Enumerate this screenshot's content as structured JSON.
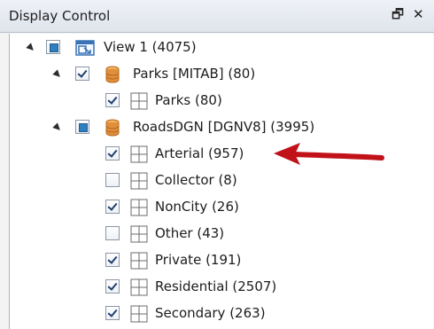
{
  "window": {
    "title": "Display Control",
    "pin_glyph": "🗗",
    "close_glyph": "✕"
  },
  "tree": {
    "view": {
      "label": "View 1 (4075)",
      "expanded": true,
      "check_state": "partial"
    },
    "parks_dataset": {
      "label": "Parks [MITAB] (80)",
      "expanded": true,
      "check_state": "checked"
    },
    "parks_layer": {
      "label": "Parks (80)",
      "check_state": "checked"
    },
    "roads_dataset": {
      "label": "RoadsDGN [DGNV8] (3995)",
      "expanded": true,
      "check_state": "partial"
    },
    "roads_layers": [
      {
        "label": "Arterial (957)",
        "check_state": "checked"
      },
      {
        "label": "Collector (8)",
        "check_state": "unchecked"
      },
      {
        "label": "NonCity (26)",
        "check_state": "checked"
      },
      {
        "label": "Other (43)",
        "check_state": "unchecked"
      },
      {
        "label": "Private (191)",
        "check_state": "checked"
      },
      {
        "label": "Residential (2507)",
        "check_state": "checked"
      },
      {
        "label": "Secondary (263)",
        "check_state": "checked"
      }
    ]
  },
  "annotation": {
    "arrow_color": "#c1121a",
    "points_to": "Arterial (957)"
  },
  "colors": {
    "accent": "#2f7fbf",
    "dataset_icon": "#e0903a",
    "arrow": "#c1121a"
  }
}
